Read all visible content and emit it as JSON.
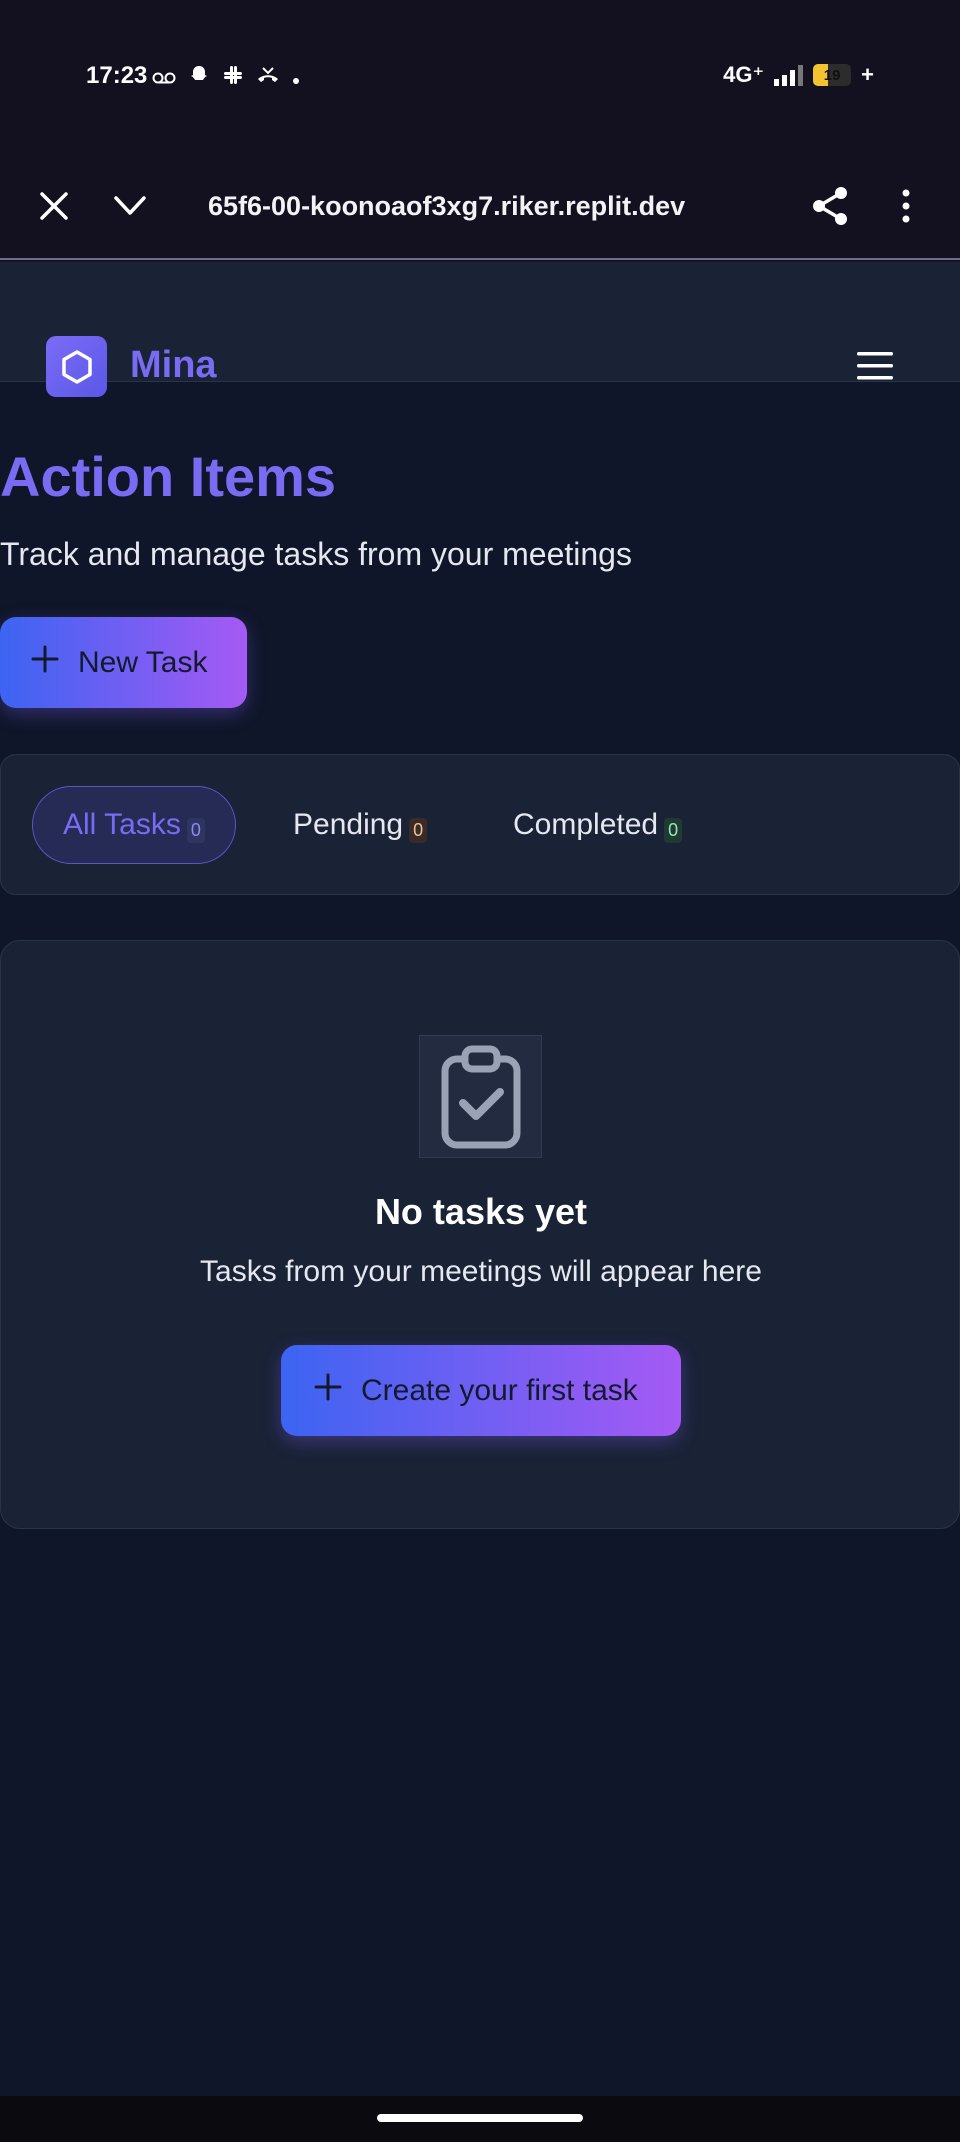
{
  "status_bar": {
    "time": "17:23",
    "icons_left": [
      "voicemail-icon",
      "snapchat-icon",
      "slack-icon",
      "call-icon",
      "dot-icon"
    ],
    "network": "4G⁺",
    "battery": "19",
    "battery_suffix": "+"
  },
  "browser": {
    "url": "65f6-00-koonoaof3xg7.riker.replit.dev"
  },
  "app": {
    "brand": "Mina"
  },
  "page": {
    "title": "Action Items",
    "subtitle": "Track and manage tasks from your meetings",
    "new_task_label": "New Task"
  },
  "tabs": [
    {
      "label": "All Tasks",
      "count": "0"
    },
    {
      "label": "Pending",
      "count": "0"
    },
    {
      "label": "Completed",
      "count": "0"
    }
  ],
  "empty_state": {
    "title": "No tasks yet",
    "description": "Tasks from your meetings will appear here",
    "cta_label": "Create your first task"
  },
  "colors": {
    "accent": "#7a6cf2",
    "background": "#0f1629",
    "card": "#1a2236",
    "gradient_start": "#3c64f2",
    "gradient_end": "#a55af4"
  }
}
